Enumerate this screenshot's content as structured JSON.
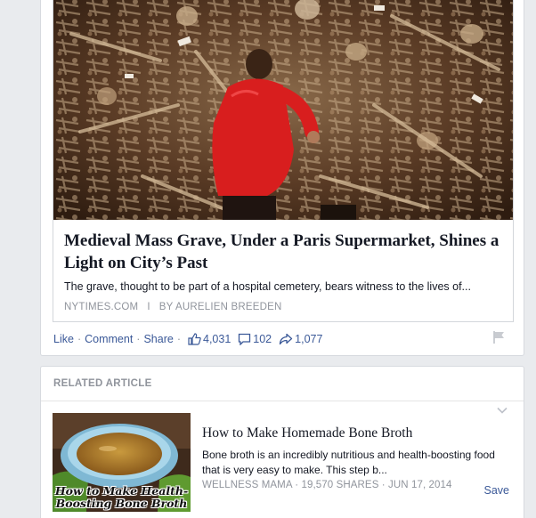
{
  "post": {
    "link": {
      "title": "Medieval Mass Grave, Under a Paris Supermarket, Shines a Light on City’s Past",
      "description": "The grave, thought to be part of a hospital cemetery, bears witness to the lives of...",
      "source": "NYTIMES.COM",
      "separator": "I",
      "author": "BY AURELIEN BREEDEN"
    },
    "actions": {
      "like": "Like",
      "comment": "Comment",
      "share": "Share",
      "separator": "·",
      "likes_count": "4,031",
      "comments_count": "102",
      "shares_count": "1,077"
    }
  },
  "related": {
    "header": "RELATED ARTICLE",
    "title": "How to Make Homemade Bone Broth",
    "description": "Bone broth is an incredibly nutritious and health-boosting food that is very easy to make. This step b...",
    "meta": "WELLNESS MAMA · 19,570 SHARES · JUN 17, 2014",
    "save": "Save",
    "thumb_caption_line1": "How to Make Health-",
    "thumb_caption_line2": "Boosting Bone Broth"
  },
  "colors": {
    "link_blue": "#3b5998",
    "muted_gray": "#90949c",
    "background": "#e9ebee"
  }
}
